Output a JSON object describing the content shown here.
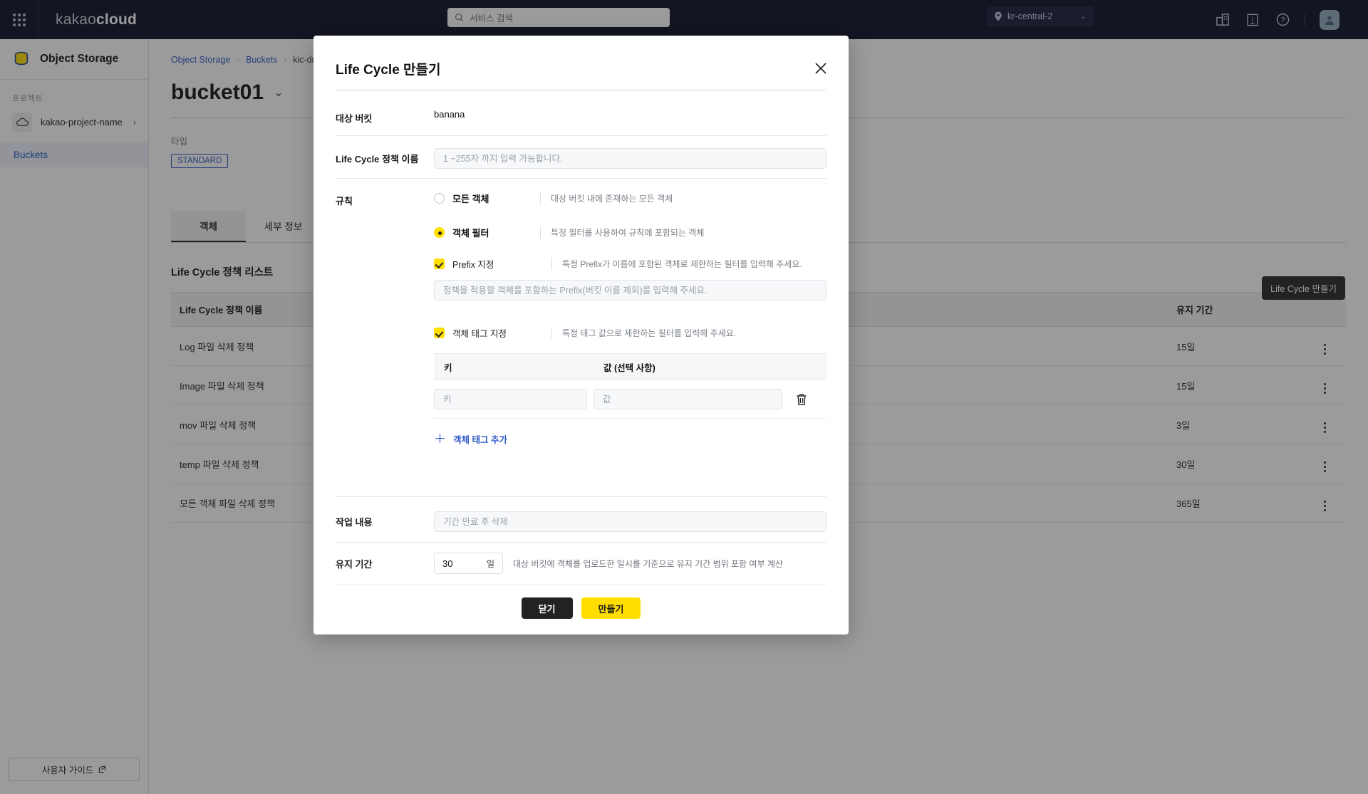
{
  "topbar": {
    "brand_prefix": "kakao",
    "brand_suffix": "cloud",
    "search_placeholder": "서비스 검색",
    "region": "kr-central-2",
    "icons": [
      "grid-launcher-icon",
      "search-icon",
      "location-pin-icon",
      "chevron-down-icon",
      "building-icon",
      "docs-icon",
      "help-icon",
      "avatar-icon"
    ]
  },
  "sidebar": {
    "service_title": "Object Storage",
    "section_label": "프로젝트",
    "project_name": "kakao-project-name",
    "nav_items": [
      {
        "label": "Buckets",
        "active": true
      }
    ],
    "guide_label": "사용자 가이드"
  },
  "main": {
    "breadcrumb": [
      "Object Storage",
      "Buckets",
      "kic-drive"
    ],
    "page_title": "bucket01",
    "type_label": "타입",
    "type_badge": "STANDARD",
    "tabs": [
      {
        "label": "객체",
        "active": true
      },
      {
        "label": "세부 정보",
        "active": false
      }
    ],
    "list_title": "Life Cycle 정책 리스트",
    "create_tooltip": "Life Cycle 만들기",
    "table": {
      "columns": [
        "Life Cycle 정책 이름",
        "유지 기간",
        ""
      ],
      "rows": [
        {
          "name": "Log 파일 삭제 정책",
          "duration": "15일"
        },
        {
          "name": "Image 파일 삭제 정책",
          "duration": "15일"
        },
        {
          "name": "mov 파일 삭제 정책",
          "duration": "3일"
        },
        {
          "name": "temp 파일 삭제 정책",
          "duration": "30일"
        },
        {
          "name": "모든 객체 파일 삭제 정책",
          "duration": "365일"
        }
      ]
    }
  },
  "modal": {
    "title": "Life Cycle 만들기",
    "close_icon": "close-icon",
    "target_bucket": {
      "label": "대상 버킷",
      "value": "banana"
    },
    "policy_name": {
      "label": "Life Cycle 정책 이름",
      "placeholder": "1 ~255자 까지 입력 가능합니다.",
      "value": ""
    },
    "rule": {
      "label": "규칙",
      "options": [
        {
          "label": "모든 객체",
          "desc": "대상 버킷 내에 존재하는 모든 객체",
          "selected": false
        },
        {
          "label": "객체 필터",
          "desc": "특정 필터를 사용하여 규칙에 포함되는 객체",
          "selected": true
        }
      ]
    },
    "prefix": {
      "label": "Prefix 지정",
      "desc": "특정 Prefix가 이름에 포함된 객체로 제한하는 필터를 입력해 주세요.",
      "checked": true,
      "placeholder": "정책을 적용할 객체를 포함하는 Prefix(버킷 이름 제외)를 입력해 주세요.",
      "value": ""
    },
    "object_tag": {
      "label": "객체 태그 지정",
      "desc": "특정 태그 값으로 제한하는 필터를 입력해 주세요.",
      "checked": true,
      "columns": {
        "key": "키",
        "value": "값 (선택 사항)"
      },
      "rows": [
        {
          "key_placeholder": "키",
          "key_value": "",
          "value_placeholder": "값",
          "value_value": "",
          "delete_icon": "trash-icon"
        }
      ],
      "add_label": "객체 태그 추가"
    },
    "action": {
      "label": "작업 내용",
      "placeholder": "기간 만료 후 삭제",
      "value": ""
    },
    "retention": {
      "label": "유지 기간",
      "value": "30",
      "unit": "일",
      "desc": "대상 버킷에 객체를 업로드한 일시를 기준으로 유지 기간 범위 포함 여부 계산"
    },
    "buttons": {
      "close": "닫기",
      "create": "만들기"
    }
  },
  "colors": {
    "brand_yellow": "#ffde00",
    "topbar_bg": "#060b24",
    "link_blue": "#2a56c6",
    "dark_button": "#222222"
  }
}
